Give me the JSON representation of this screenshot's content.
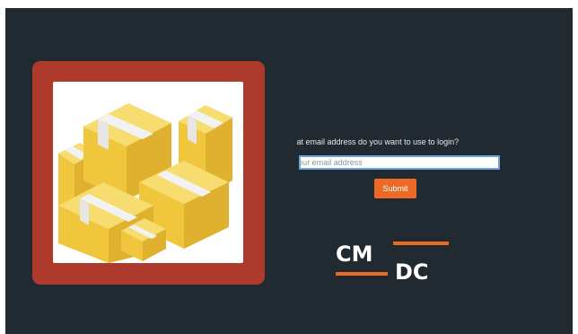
{
  "login": {
    "prompt": "What email address do you want to use to login?",
    "email_placeholder": "Your email address",
    "email_value": "",
    "submit_label": "Submit"
  },
  "logo": {
    "text_top": "CM",
    "text_bottom": "DC",
    "accent_color": "#ec6a25"
  },
  "colors": {
    "background": "#222a31",
    "card_border": "#ad3a2d",
    "button": "#ec6a25",
    "input_focus": "#6aa8df"
  },
  "illustration": {
    "icon": "stacked-boxes-icon"
  }
}
